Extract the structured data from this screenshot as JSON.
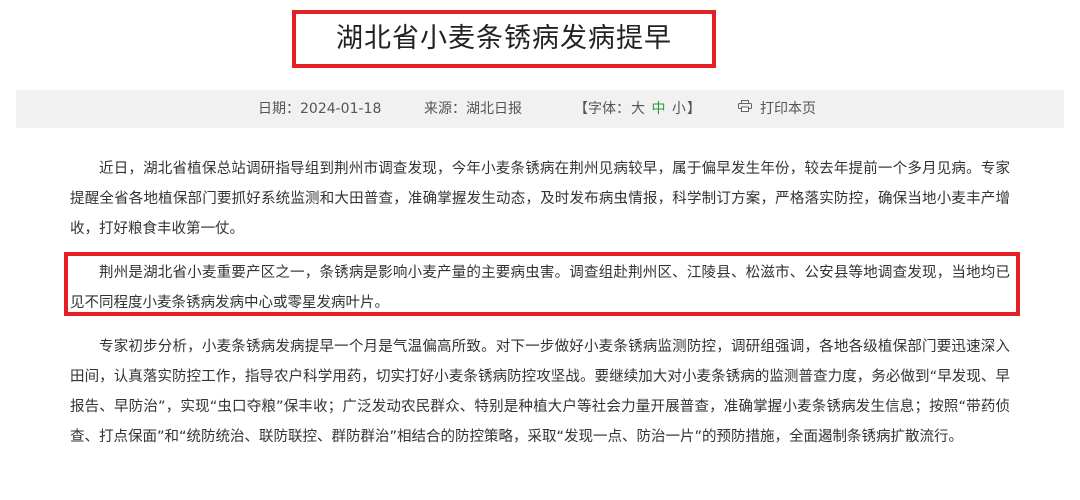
{
  "article": {
    "title": "湖北省小麦条锈病发病提早",
    "meta": {
      "date": "日期：2024-01-18",
      "source": "来源：湖北日报",
      "font_open": "【字体：",
      "font_large": "大",
      "font_medium": "中",
      "font_small": "小",
      "font_close": "】",
      "print_label": "打印本页",
      "print_icon": "printer-icon",
      "font_medium_color": "#2e9a3a"
    },
    "paragraphs": [
      "近日，湖北省植保总站调研指导组到荆州市调查发现，今年小麦条锈病在荆州见病较早，属于偏早发生年份，较去年提前一个多月见病。专家提醒全省各地植保部门要抓好系统监测和大田普查，准确掌握发生动态，及时发布病虫情报，科学制订方案，严格落实防控，确保当地小麦丰产增收，打好粮食丰收第一仗。",
      "荆州是湖北省小麦重要产区之一，条锈病是影响小麦产量的主要病虫害。调查组赴荆州区、江陵县、松滋市、公安县等地调查发现，当地均已见不同程度小麦条锈病发病中心或零星发病叶片。",
      "专家初步分析，小麦条锈病发病提早一个月是气温偏高所致。对下一步做好小麦条锈病监测防控，调研组强调，各地各级植保部门要迅速深入田间，认真落实防控工作，指导农户科学用药，切实打好小麦条锈病防控攻坚战。要继续加大对小麦条锈病的监测普查力度，务必做到“早发现、早报告、早防治”，实现“虫口夺粮”保丰收；广泛发动农民群众、特别是种植大户等社会力量开展普查，准确掌握小麦条锈病发生信息；按照“带药侦查、打点保面”和“统防统治、联防联控、群防群治”相结合的防控策略，采取“发现一点、防治一片”的预防措施，全面遏制条锈病扩散流行。"
    ],
    "highlight_color": "#e41f26"
  }
}
